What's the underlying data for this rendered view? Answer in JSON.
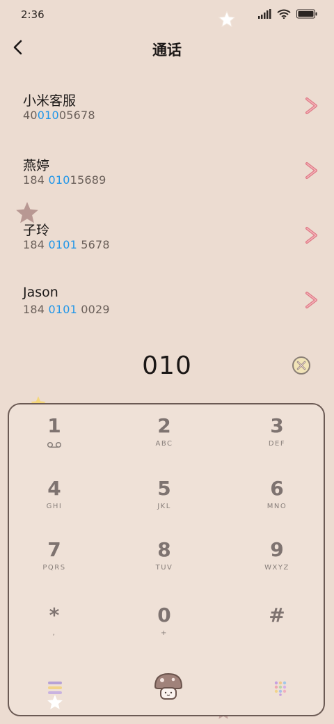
{
  "status_bar": {
    "time": "2:36"
  },
  "header": {
    "title": "通话"
  },
  "contacts": [
    {
      "name": "小米客服",
      "num_pre": "40",
      "num_hl": "010",
      "num_post": "05678"
    },
    {
      "name": "燕婷",
      "num_pre": "184 ",
      "num_hl": "010",
      "num_post": "15689"
    },
    {
      "name": "子玲",
      "num_pre": "184 ",
      "num_hl": "0101",
      "num_post": " 5678"
    },
    {
      "name": "Jason",
      "num_pre": "184 ",
      "num_hl": "0101",
      "num_post": " 0029"
    }
  ],
  "dialer": {
    "entered": "010"
  },
  "keys": [
    {
      "digit": "1",
      "letters": ""
    },
    {
      "digit": "2",
      "letters": "ABC"
    },
    {
      "digit": "3",
      "letters": "DEF"
    },
    {
      "digit": "4",
      "letters": "GHI"
    },
    {
      "digit": "5",
      "letters": "JKL"
    },
    {
      "digit": "6",
      "letters": "MNO"
    },
    {
      "digit": "7",
      "letters": "PQRS"
    },
    {
      "digit": "8",
      "letters": "TUV"
    },
    {
      "digit": "9",
      "letters": "WXYZ"
    },
    {
      "digit": "*",
      "letters": ","
    },
    {
      "digit": "0",
      "letters": "+"
    },
    {
      "digit": "#",
      "letters": ""
    }
  ],
  "colors": {
    "background": "#ecdcd1",
    "highlight": "#2196e8",
    "arrow": "#e07a86",
    "key_digit": "#7e7370"
  },
  "icons": [
    "back-arrow-icon",
    "signal-icon",
    "wifi-icon",
    "battery-icon",
    "chevron-right-icon",
    "clear-icon",
    "voicemail-icon",
    "menu-icon",
    "call-icon",
    "dialpad-icon"
  ]
}
